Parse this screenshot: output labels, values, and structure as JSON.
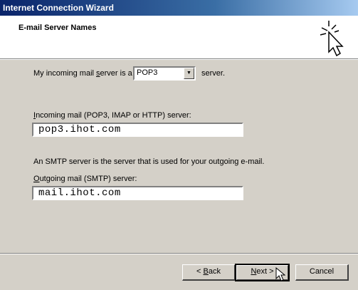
{
  "window": {
    "title": "Internet Connection Wizard"
  },
  "header": {
    "title": "E-mail Server Names",
    "icon": "wizard-sparkle-cursor-icon"
  },
  "incoming_type": {
    "prefix": "My incoming mail ",
    "underlined": "s",
    "suffix": "erver is a",
    "selected": "POP3",
    "after": "server."
  },
  "incoming": {
    "label_underlined": "I",
    "label_rest": "ncoming mail (POP3, IMAP or HTTP) server:",
    "value": "pop3.ihot.com"
  },
  "smtp_note": "An SMTP server is the server that is used for your outgoing e-mail.",
  "outgoing": {
    "label_underlined": "O",
    "label_rest": "utgoing mail (SMTP) server:",
    "value": "mail.ihot.com"
  },
  "buttons": {
    "back_prefix": "< ",
    "back_underlined": "B",
    "back_rest": "ack",
    "next_underlined": "N",
    "next_rest": "ext >",
    "cancel": "Cancel"
  },
  "colors": {
    "dialog": "#d4d0c8",
    "titlebar_start": "#0a246a",
    "titlebar_end": "#a6caf0"
  }
}
